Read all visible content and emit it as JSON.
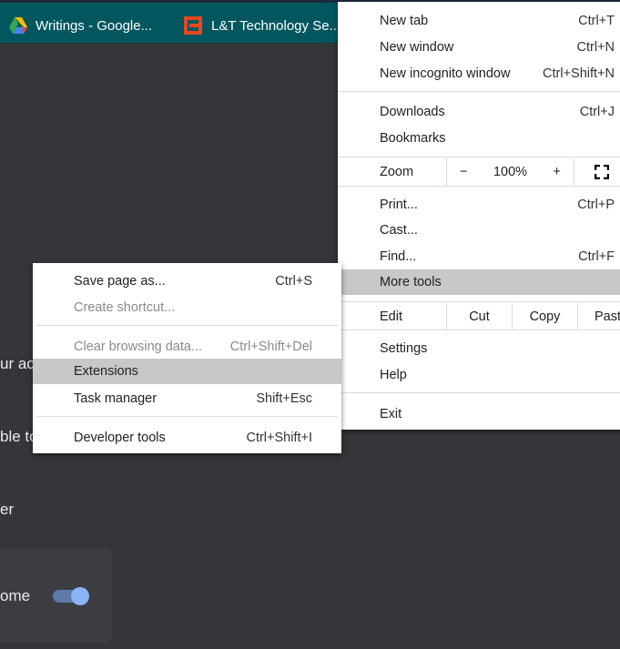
{
  "tabs": [
    {
      "title": "Writings - Google...",
      "icon": "google-drive-icon"
    },
    {
      "title": "L&T Technology Se...",
      "icon": "lt-logo-icon"
    }
  ],
  "background": {
    "fragments": [
      "ur ac",
      "ble to",
      "er",
      "ome"
    ],
    "toggle_on": true
  },
  "main_menu": {
    "new_tab": {
      "label": "New tab",
      "shortcut": "Ctrl+T"
    },
    "new_window": {
      "label": "New window",
      "shortcut": "Ctrl+N"
    },
    "new_incognito": {
      "label": "New incognito window",
      "shortcut": "Ctrl+Shift+N"
    },
    "downloads": {
      "label": "Downloads",
      "shortcut": "Ctrl+J"
    },
    "bookmarks": {
      "label": "Bookmarks"
    },
    "zoom": {
      "label": "Zoom",
      "minus": "−",
      "value": "100%",
      "plus": "+"
    },
    "print": {
      "label": "Print...",
      "shortcut": "Ctrl+P"
    },
    "cast": {
      "label": "Cast..."
    },
    "find": {
      "label": "Find...",
      "shortcut": "Ctrl+F"
    },
    "more_tools": {
      "label": "More tools"
    },
    "edit": {
      "label": "Edit",
      "cut": "Cut",
      "copy": "Copy",
      "paste": "Past"
    },
    "settings": {
      "label": "Settings"
    },
    "help": {
      "label": "Help"
    },
    "exit": {
      "label": "Exit"
    }
  },
  "submenu": {
    "save_page": {
      "label": "Save page as...",
      "shortcut": "Ctrl+S"
    },
    "create_shortcut": {
      "label": "Create shortcut..."
    },
    "clear_data": {
      "label": "Clear browsing data...",
      "shortcut": "Ctrl+Shift+Del"
    },
    "extensions": {
      "label": "Extensions"
    },
    "task_manager": {
      "label": "Task manager",
      "shortcut": "Shift+Esc"
    },
    "dev_tools": {
      "label": "Developer tools",
      "shortcut": "Ctrl+Shift+I"
    }
  }
}
